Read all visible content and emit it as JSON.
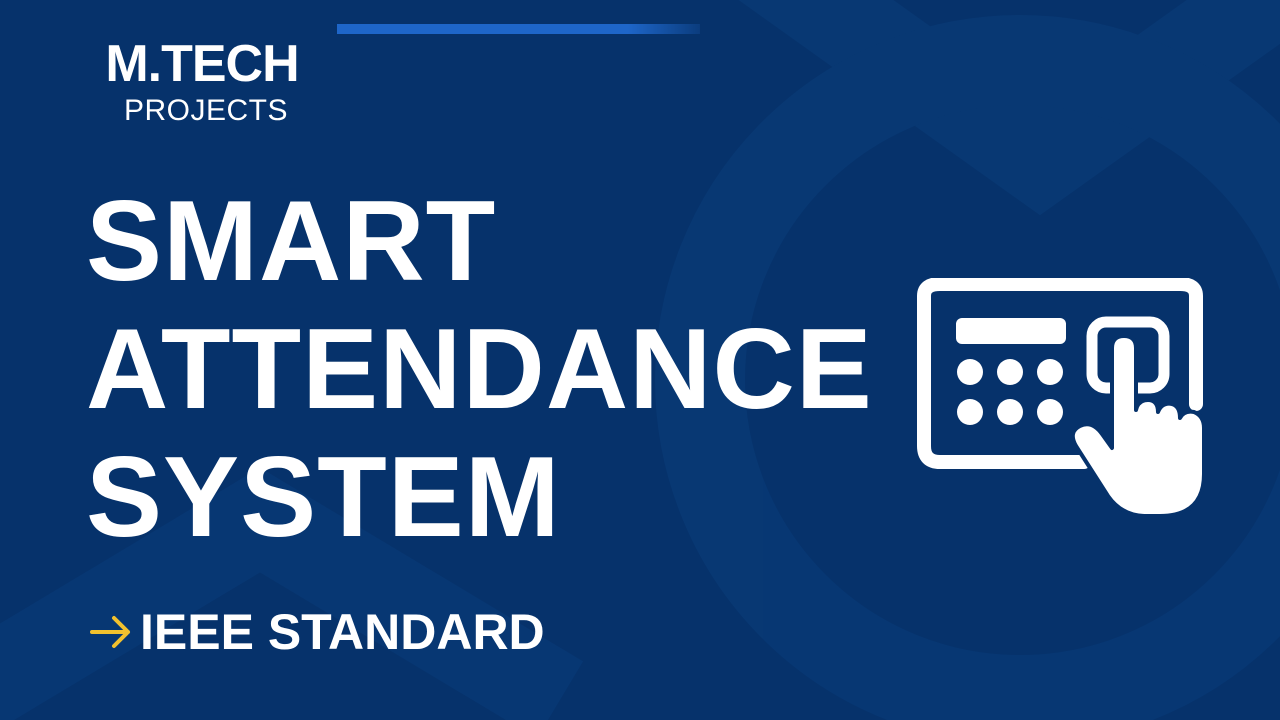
{
  "brand": {
    "name": "M.TECH",
    "subtitle": "PROJECTS"
  },
  "headline": {
    "line1": "SMART",
    "line2": "ATTENDANCE",
    "line3": "SYSTEM"
  },
  "tagline": {
    "text": "IEEE STANDARD",
    "arrow_icon": "arrow-right-icon"
  },
  "illustration": {
    "icon": "touch-keypad-icon"
  },
  "colors": {
    "background": "#06326b",
    "accent_bar": "#1e66c9",
    "arrow": "#f2c12e",
    "text": "#ffffff"
  }
}
